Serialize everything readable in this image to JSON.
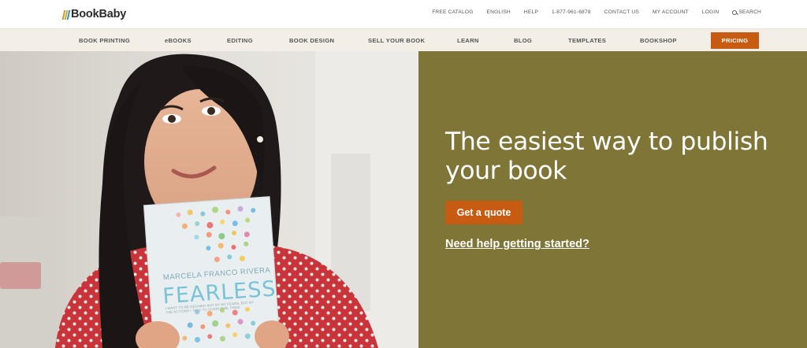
{
  "header": {
    "logo_text": "BookBaby",
    "logo_bar_colors": [
      "#e98b2a",
      "#9cbb3c",
      "#3a8dc6"
    ],
    "utility_links": [
      {
        "name": "free-catalog-link",
        "label": "FREE CATALOG"
      },
      {
        "name": "english-link",
        "label": "ENGLISH"
      },
      {
        "name": "help-link",
        "label": "HELP"
      },
      {
        "name": "phone-link",
        "label": "1-877-961-6878"
      },
      {
        "name": "contact-us-link",
        "label": "CONTACT US"
      },
      {
        "name": "my-account-link",
        "label": "MY ACCOUNT"
      },
      {
        "name": "login-link",
        "label": "LOGIN"
      }
    ],
    "search_label": "SEARCH"
  },
  "nav": {
    "items": [
      {
        "name": "nav-book-printing",
        "label": "BOOK PRINTING"
      },
      {
        "name": "nav-ebooks",
        "label": "eBOOKS"
      },
      {
        "name": "nav-editing",
        "label": "EDITING"
      },
      {
        "name": "nav-book-design",
        "label": "BOOK DESIGN"
      },
      {
        "name": "nav-sell-your-book",
        "label": "SELL YOUR BOOK"
      },
      {
        "name": "nav-learn",
        "label": "LEARN"
      },
      {
        "name": "nav-blog",
        "label": "BLOG"
      },
      {
        "name": "nav-templates",
        "label": "TEMPLATES"
      },
      {
        "name": "nav-bookshop",
        "label": "BOOKSHOP"
      }
    ],
    "pricing_label": "PRICING"
  },
  "hero": {
    "title": "The easiest way to publish your book",
    "cta_label": "Get a quote",
    "help_link": "Need help getting started?",
    "panel_color": "#7f7536",
    "accent_color": "#c75b12",
    "book": {
      "author": "MARCELA FRANCO RIVERA",
      "title": "FEARLESS",
      "blurb": "I WANT TO BE DEFINED NOT BY MY FEARS, BUT BY THE ACTIONS I TAKE TO OVERCOME THEM."
    }
  }
}
